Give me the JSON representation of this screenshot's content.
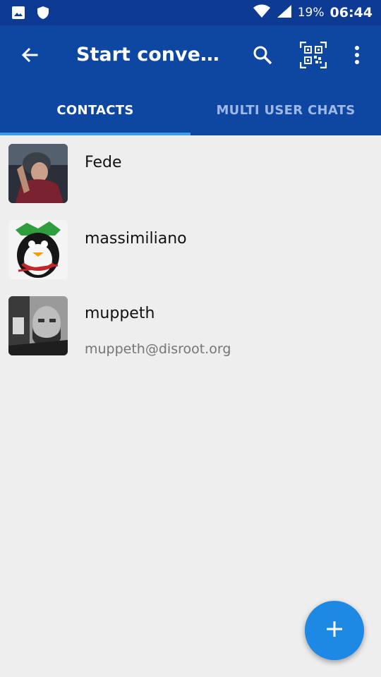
{
  "status_bar": {
    "left_icons": [
      "image-icon",
      "shield-icon"
    ],
    "right_icons": [
      "wifi-icon",
      "cell-signal-icon"
    ],
    "battery": "19%",
    "time": "06:44"
  },
  "toolbar": {
    "title": "Start conversation",
    "icons": [
      "back-arrow-icon",
      "search-icon",
      "qr-code-icon",
      "more-vert-icon"
    ]
  },
  "tabs": [
    {
      "label": "CONTACTS",
      "active": true
    },
    {
      "label": "MULTI USER CHATS",
      "active": false
    }
  ],
  "contacts": [
    {
      "name": "Fede",
      "jid": ""
    },
    {
      "name": "massimiliano",
      "jid": ""
    },
    {
      "name": "muppeth",
      "jid": "muppeth@disroot.org"
    }
  ],
  "fab": {
    "icon": "plus-icon"
  },
  "colors": {
    "status_bar": "#0d3a92",
    "app_bar": "#0e47a1",
    "tab_indicator": "#3d9be9",
    "fab": "#1e88e5",
    "background": "#eeeeee"
  }
}
